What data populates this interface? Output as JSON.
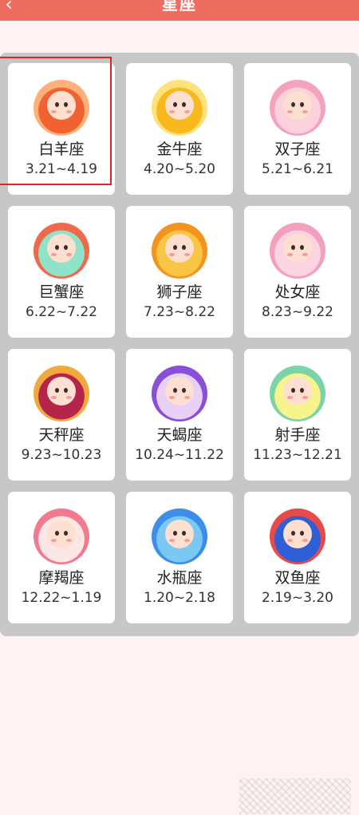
{
  "header": {
    "title": "星座",
    "back_icon": "chevron-left-icon"
  },
  "zodiac": [
    {
      "name": "白羊座",
      "dates": "3.21~4.19",
      "color": "#f06232",
      "ring": "#ffb07a",
      "icon": "aries-sheep-icon",
      "selected": true
    },
    {
      "name": "金牛座",
      "dates": "4.20~5.20",
      "color": "#f7b91e",
      "ring": "#ffe27a",
      "icon": "taurus-bull-icon"
    },
    {
      "name": "双子座",
      "dates": "5.21~6.21",
      "color": "#fbd2dc",
      "ring": "#f5a3bd",
      "icon": "gemini-twins-icon"
    },
    {
      "name": "巨蟹座",
      "dates": "6.22~7.22",
      "color": "#8fe3c9",
      "ring": "#ee6a4a",
      "icon": "cancer-crab-icon"
    },
    {
      "name": "狮子座",
      "dates": "7.23~8.22",
      "color": "#f9c544",
      "ring": "#f49420",
      "icon": "leo-lion-icon"
    },
    {
      "name": "处女座",
      "dates": "8.23~9.22",
      "color": "#fbd4e2",
      "ring": "#f39fbe",
      "icon": "virgo-maiden-icon"
    },
    {
      "name": "天秤座",
      "dates": "9.23~10.23",
      "color": "#b3254a",
      "ring": "#f2a93b",
      "icon": "libra-scales-icon"
    },
    {
      "name": "天蝎座",
      "dates": "10.24~11.22",
      "color": "#e9d0f6",
      "ring": "#8a4fd8",
      "icon": "scorpio-scorpion-icon"
    },
    {
      "name": "射手座",
      "dates": "11.23~12.21",
      "color": "#f7f48c",
      "ring": "#7bd3a8",
      "icon": "sagittarius-archer-icon"
    },
    {
      "name": "摩羯座",
      "dates": "12.22~1.19",
      "color": "#fde6e6",
      "ring": "#f3798f",
      "icon": "capricorn-goat-icon"
    },
    {
      "name": "水瓶座",
      "dates": "1.20~2.18",
      "color": "#7bc8f5",
      "ring": "#3d8ee8",
      "icon": "aquarius-water-icon"
    },
    {
      "name": "双鱼座",
      "dates": "2.19~3.20",
      "color": "#2f5fd6",
      "ring": "#e64a4a",
      "icon": "pisces-mermaid-icon"
    }
  ]
}
